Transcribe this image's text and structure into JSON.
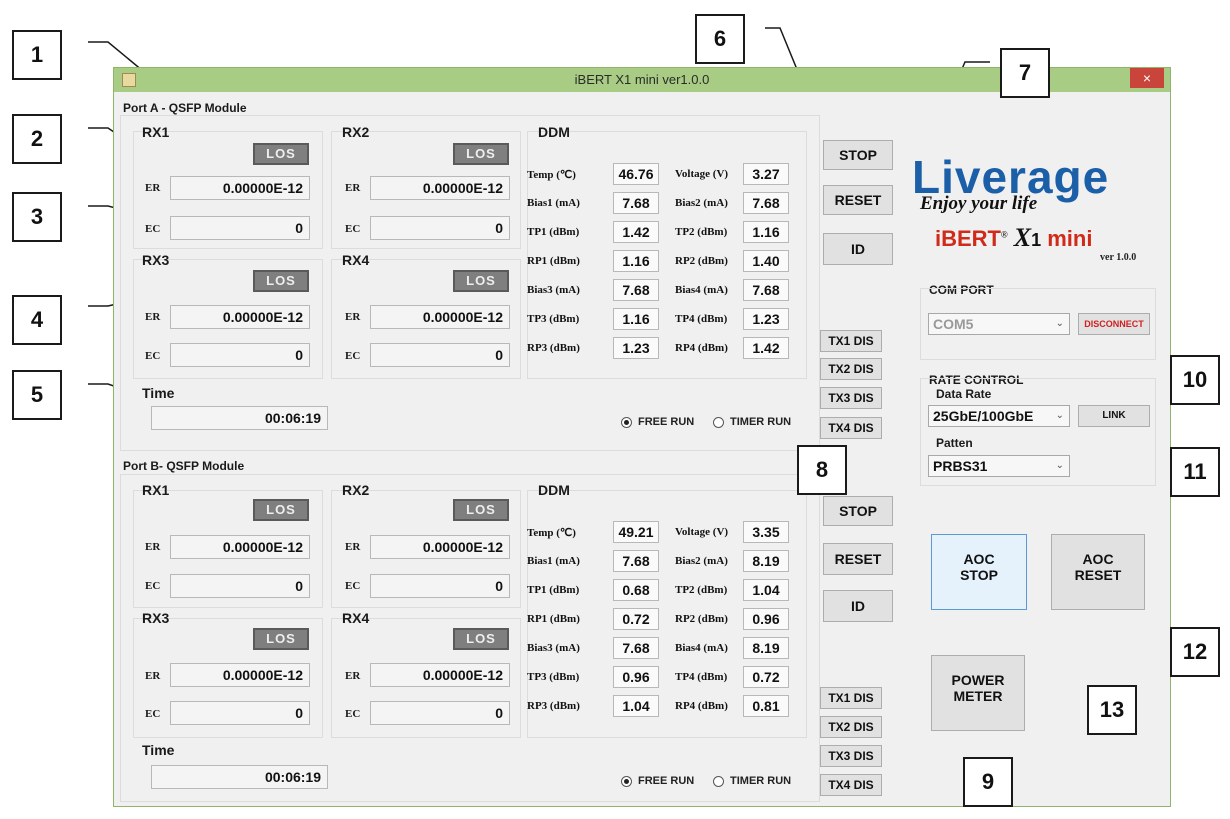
{
  "window": {
    "title": "iBERT X1 mini ver1.0.0",
    "close_glyph": "×"
  },
  "ports": [
    {
      "title": "Port A - QSFP Module",
      "rx": [
        {
          "label": "RX1",
          "los": "LOS",
          "er_label": "ER",
          "er": "0.00000E-12",
          "ec_label": "EC",
          "ec": "0"
        },
        {
          "label": "RX2",
          "los": "LOS",
          "er_label": "ER",
          "er": "0.00000E-12",
          "ec_label": "EC",
          "ec": "0"
        },
        {
          "label": "RX3",
          "los": "LOS",
          "er_label": "ER",
          "er": "0.00000E-12",
          "ec_label": "EC",
          "ec": "0"
        },
        {
          "label": "RX4",
          "los": "LOS",
          "er_label": "ER",
          "er": "0.00000E-12",
          "ec_label": "EC",
          "ec": "0"
        }
      ],
      "ddm": {
        "title": "DDM",
        "rows": [
          {
            "l1": "Temp (℃)",
            "v1": "46.76",
            "l2": "Voltage (V)",
            "v2": "3.27"
          },
          {
            "l1": "Bias1 (mA)",
            "v1": "7.68",
            "l2": "Bias2 (mA)",
            "v2": "7.68"
          },
          {
            "l1": "TP1 (dBm)",
            "v1": "1.42",
            "l2": "TP2 (dBm)",
            "v2": "1.16"
          },
          {
            "l1": "RP1 (dBm)",
            "v1": "1.16",
            "l2": "RP2 (dBm)",
            "v2": "1.40"
          },
          {
            "l1": "Bias3 (mA)",
            "v1": "7.68",
            "l2": "Bias4 (mA)",
            "v2": "7.68"
          },
          {
            "l1": "TP3 (dBm)",
            "v1": "1.16",
            "l2": "TP4 (dBm)",
            "v2": "1.23"
          },
          {
            "l1": "RP3 (dBm)",
            "v1": "1.23",
            "l2": "RP4 (dBm)",
            "v2": "1.42"
          }
        ]
      },
      "time_label": "Time",
      "time": "00:06:19",
      "free_run": "FREE RUN",
      "timer_run": "TIMER RUN",
      "stop": "STOP",
      "reset": "RESET",
      "id": "ID",
      "tx": [
        "TX1 DIS",
        "TX2 DIS",
        "TX3 DIS",
        "TX4 DIS"
      ]
    },
    {
      "title": "Port B- QSFP Module",
      "rx": [
        {
          "label": "RX1",
          "los": "LOS",
          "er_label": "ER",
          "er": "0.00000E-12",
          "ec_label": "EC",
          "ec": "0"
        },
        {
          "label": "RX2",
          "los": "LOS",
          "er_label": "ER",
          "er": "0.00000E-12",
          "ec_label": "EC",
          "ec": "0"
        },
        {
          "label": "RX3",
          "los": "LOS",
          "er_label": "ER",
          "er": "0.00000E-12",
          "ec_label": "EC",
          "ec": "0"
        },
        {
          "label": "RX4",
          "los": "LOS",
          "er_label": "ER",
          "er": "0.00000E-12",
          "ec_label": "EC",
          "ec": "0"
        }
      ],
      "ddm": {
        "title": "DDM",
        "rows": [
          {
            "l1": "Temp (℃)",
            "v1": "49.21",
            "l2": "Voltage (V)",
            "v2": "3.35"
          },
          {
            "l1": "Bias1 (mA)",
            "v1": "7.68",
            "l2": "Bias2 (mA)",
            "v2": "8.19"
          },
          {
            "l1": "TP1 (dBm)",
            "v1": "0.68",
            "l2": "TP2 (dBm)",
            "v2": "1.04"
          },
          {
            "l1": "RP1 (dBm)",
            "v1": "0.72",
            "l2": "RP2 (dBm)",
            "v2": "0.96"
          },
          {
            "l1": "Bias3 (mA)",
            "v1": "7.68",
            "l2": "Bias4 (mA)",
            "v2": "8.19"
          },
          {
            "l1": "TP3 (dBm)",
            "v1": "0.96",
            "l2": "TP4 (dBm)",
            "v2": "0.72"
          },
          {
            "l1": "RP3 (dBm)",
            "v1": "1.04",
            "l2": "RP4 (dBm)",
            "v2": "0.81"
          }
        ]
      },
      "time_label": "Time",
      "time": "00:06:19",
      "free_run": "FREE RUN",
      "timer_run": "TIMER RUN",
      "stop": "STOP",
      "reset": "RESET",
      "id": "ID",
      "tx": [
        "TX1 DIS",
        "TX2 DIS",
        "TX3 DIS",
        "TX4 DIS"
      ]
    }
  ],
  "logo": {
    "brand": "Liverage",
    "tagline": "Enjoy your life",
    "product_a": "iBERT",
    "product_x": "X",
    "product_1": "1",
    "product_mini": "mini",
    "version": "ver 1.0.0"
  },
  "com_port": {
    "title": "COM PORT",
    "value": "COM5",
    "disconnect": "DISCONNECT"
  },
  "rate_control": {
    "title": "RATE CONTROL",
    "data_rate_label": "Data Rate",
    "data_rate": "25GbE/100GbE",
    "link": "LINK",
    "pattern_label": "Patten",
    "pattern": "PRBS31"
  },
  "aoc_stop": {
    "line1": "AOC",
    "line2": "STOP"
  },
  "aoc_reset": {
    "line1": "AOC",
    "line2": "RESET"
  },
  "power_meter": {
    "line1": "POWER",
    "line2": "METER"
  },
  "callouts": [
    "1",
    "2",
    "3",
    "4",
    "5",
    "6",
    "7",
    "8",
    "9",
    "10",
    "11",
    "12",
    "13"
  ],
  "colors": {
    "titlebar": "#a9cc84",
    "close": "#c9443a",
    "los": "#7f7f7f",
    "brand_blue": "#1a5fa8",
    "brand_orange": "#e07b1a",
    "disconnect_red": "#d02020"
  }
}
